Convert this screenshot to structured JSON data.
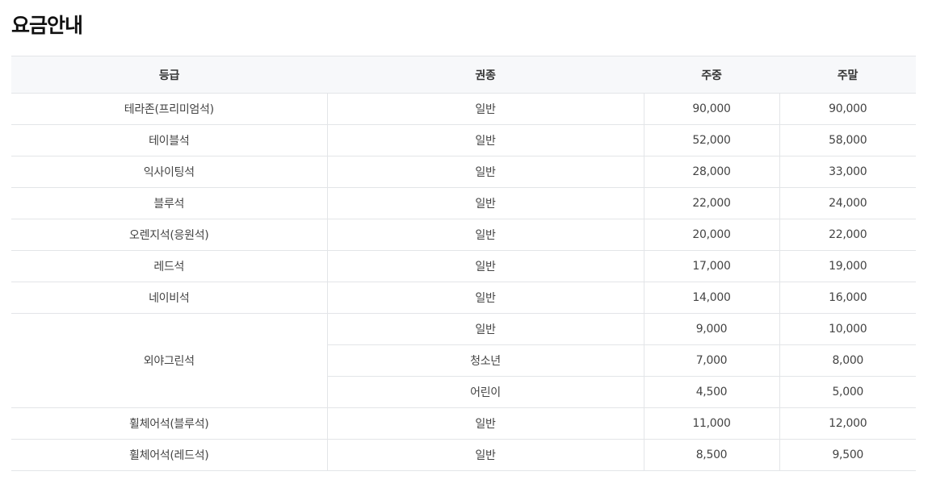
{
  "page": {
    "title": "요금안내"
  },
  "table": {
    "headers": [
      "등급",
      "권종",
      "주중",
      "주말"
    ],
    "rows": [
      {
        "grade": "테라존(프리미엄석)",
        "ticket": "일반",
        "weekday": "90,000",
        "weekend": "90,000"
      },
      {
        "grade": "테이블석",
        "ticket": "일반",
        "weekday": "52,000",
        "weekend": "58,000"
      },
      {
        "grade": "익사이팅석",
        "ticket": "일반",
        "weekday": "28,000",
        "weekend": "33,000"
      },
      {
        "grade": "블루석",
        "ticket": "일반",
        "weekday": "22,000",
        "weekend": "24,000"
      },
      {
        "grade": "오렌지석(응원석)",
        "ticket": "일반",
        "weekday": "20,000",
        "weekend": "22,000"
      },
      {
        "grade": "레드석",
        "ticket": "일반",
        "weekday": "17,000",
        "weekend": "19,000"
      },
      {
        "grade": "네이비석",
        "ticket": "일반",
        "weekday": "14,000",
        "weekend": "16,000"
      },
      {
        "grade": "외야그린석",
        "ticket": "일반",
        "weekday": "9,000",
        "weekend": "10,000"
      },
      {
        "grade": "",
        "ticket": "청소년",
        "weekday": "7,000",
        "weekend": "8,000"
      },
      {
        "grade": "",
        "ticket": "어린이",
        "weekday": "4,500",
        "weekend": "5,000"
      },
      {
        "grade": "휠체어석(블루석)",
        "ticket": "일반",
        "weekday": "11,000",
        "weekend": "12,000"
      },
      {
        "grade": "휠체어석(레드석)",
        "ticket": "일반",
        "weekday": "8,500",
        "weekend": "9,500"
      }
    ]
  }
}
